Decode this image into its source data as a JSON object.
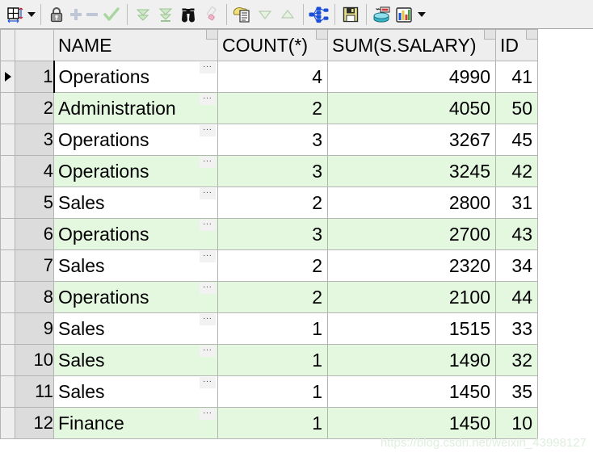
{
  "toolbar": {
    "items": [
      {
        "name": "grid-layout-icon",
        "label": "Grid Layout",
        "enabled": true
      },
      {
        "name": "dropdown-caret-icon",
        "label": "Grid Layout Menu",
        "enabled": true
      },
      {
        "name": "lock-icon",
        "label": "Lock Record",
        "enabled": true
      },
      {
        "name": "plus-icon",
        "label": "Insert Record",
        "enabled": false
      },
      {
        "name": "minus-icon",
        "label": "Delete Record",
        "enabled": false
      },
      {
        "name": "check-icon",
        "label": "Commit Changes",
        "enabled": false
      },
      {
        "name": "fetch-next-icon",
        "label": "Fetch Next Page",
        "enabled": false
      },
      {
        "name": "fetch-all-icon",
        "label": "Fetch All Rows",
        "enabled": false
      },
      {
        "name": "binoculars-icon",
        "label": "Find",
        "enabled": true
      },
      {
        "name": "eraser-icon",
        "label": "Clear Filter",
        "enabled": false
      },
      {
        "name": "copy-rows-icon",
        "label": "Copy Rows",
        "enabled": true
      },
      {
        "name": "sort-desc-icon",
        "label": "Sort Descending",
        "enabled": false
      },
      {
        "name": "sort-asc-icon",
        "label": "Sort Ascending",
        "enabled": false
      },
      {
        "name": "network-icon",
        "label": "Explain Plan",
        "enabled": true
      },
      {
        "name": "save-icon",
        "label": "Save Results",
        "enabled": true
      },
      {
        "name": "export-db-icon",
        "label": "Export Data",
        "enabled": true
      },
      {
        "name": "chart-icon",
        "label": "Chart",
        "enabled": true
      },
      {
        "name": "chart-caret-icon",
        "label": "Chart Menu",
        "enabled": true
      }
    ]
  },
  "grid": {
    "columns": [
      {
        "key": "name",
        "label": "NAME"
      },
      {
        "key": "count",
        "label": "COUNT(*)"
      },
      {
        "key": "sum",
        "label": "SUM(S.SALARY)"
      },
      {
        "key": "id",
        "label": "ID"
      }
    ],
    "current_row": 1,
    "rows": [
      {
        "n": "1",
        "name": "Operations",
        "count": "4",
        "sum": "4990",
        "id": "41"
      },
      {
        "n": "2",
        "name": "Administration",
        "count": "2",
        "sum": "4050",
        "id": "50"
      },
      {
        "n": "3",
        "name": "Operations",
        "count": "3",
        "sum": "3267",
        "id": "45"
      },
      {
        "n": "4",
        "name": "Operations",
        "count": "3",
        "sum": "3245",
        "id": "42"
      },
      {
        "n": "5",
        "name": "Sales",
        "count": "2",
        "sum": "2800",
        "id": "31"
      },
      {
        "n": "6",
        "name": "Operations",
        "count": "3",
        "sum": "2700",
        "id": "43"
      },
      {
        "n": "7",
        "name": "Sales",
        "count": "2",
        "sum": "2320",
        "id": "34"
      },
      {
        "n": "8",
        "name": "Operations",
        "count": "2",
        "sum": "2100",
        "id": "44"
      },
      {
        "n": "9",
        "name": "Sales",
        "count": "1",
        "sum": "1515",
        "id": "33"
      },
      {
        "n": "10",
        "name": "Sales",
        "count": "1",
        "sum": "1490",
        "id": "32"
      },
      {
        "n": "11",
        "name": "Sales",
        "count": "1",
        "sum": "1450",
        "id": "35"
      },
      {
        "n": "12",
        "name": "Finance",
        "count": "1",
        "sum": "1450",
        "id": "10"
      }
    ],
    "cell_expand_glyph": "..."
  },
  "watermark": {
    "text": "https://blog.csdn.net/weixin_43998127"
  },
  "colors": {
    "row_alt_green": "#e4f8e0",
    "row_white": "#ffffff",
    "header_bg": "#eeeeee",
    "rownum_bg": "#dcdcdc",
    "toolbar_bg": "#f0f0f0",
    "grid_line": "#b4b4b4"
  }
}
